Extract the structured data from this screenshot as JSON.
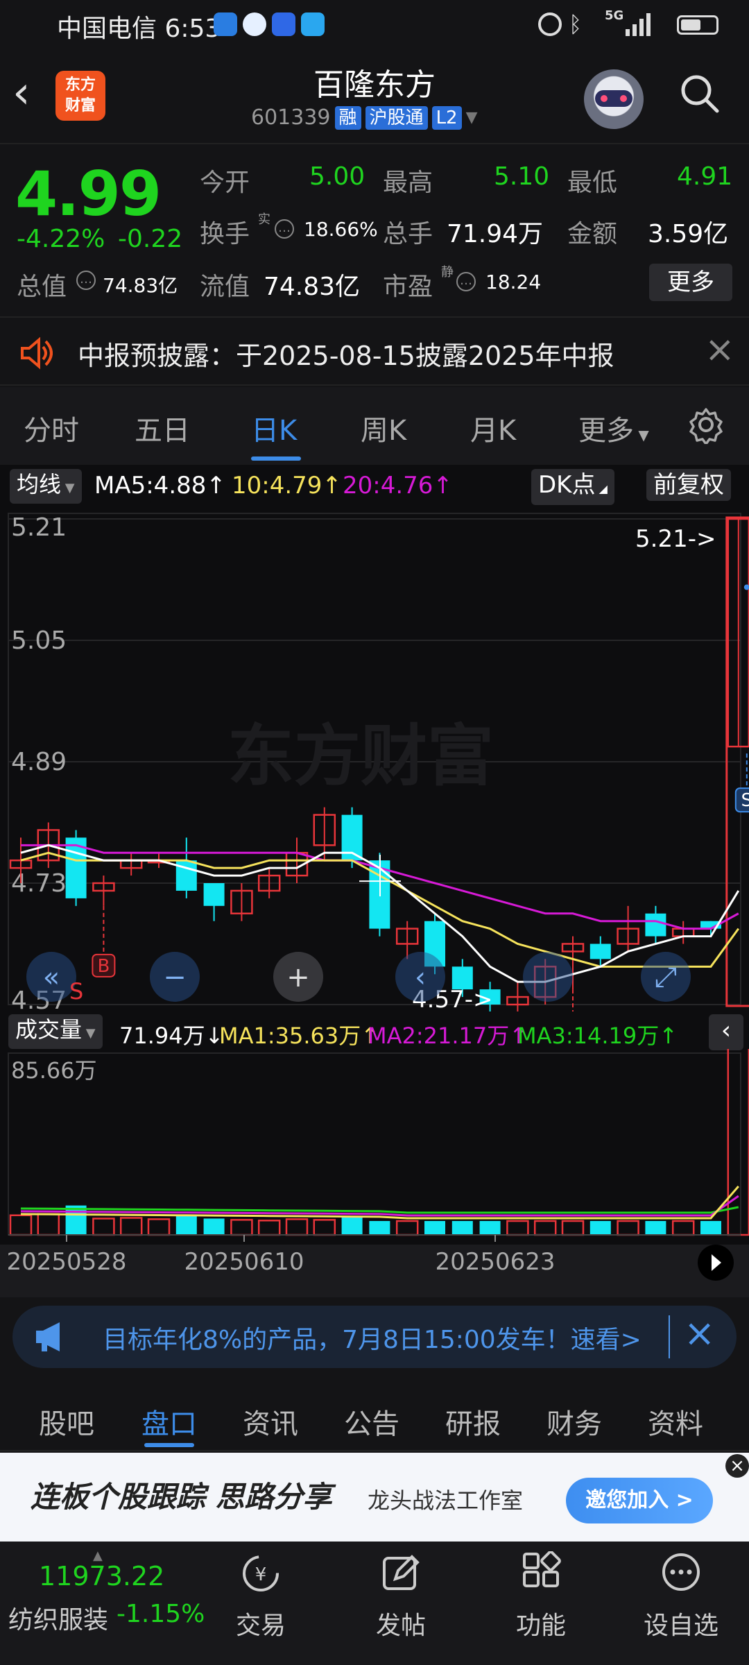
{
  "status_bar": {
    "carrier": "中国电信 6:53",
    "net": "5G"
  },
  "header": {
    "logo_line1": "东方",
    "logo_line2": "财富",
    "title": "百隆东方",
    "code": "601339",
    "tags": [
      "融",
      "沪股通",
      "L2"
    ]
  },
  "quote": {
    "price": "4.99",
    "change_pct": "-4.22%",
    "change_amt": "-0.22",
    "open_label": "今开",
    "open": "5.00",
    "high_label": "最高",
    "high": "5.10",
    "low_label": "最低",
    "low": "4.91",
    "turnover_label": "换手",
    "turnover_sup": "实",
    "turnover": "18.66%",
    "volume_label": "总手",
    "volume": "71.94万",
    "amount_label": "金额",
    "amount": "3.59亿",
    "mktcap_label": "总值",
    "mktcap": "74.83亿",
    "float_label": "流值",
    "float": "74.83亿",
    "pe_label": "市盈",
    "pe_sup": "静",
    "pe": "18.24",
    "more": "更多"
  },
  "notice": {
    "text": "中报预披露：于2025-08-15披露2025年中报"
  },
  "tabs": [
    "分时",
    "五日",
    "日K",
    "周K",
    "月K",
    "更多"
  ],
  "active_tab": "日K",
  "ma_bar": {
    "selector": "均线",
    "ma5": "MA5:4.88",
    "ma10": "10:4.79",
    "ma20": "20:4.76",
    "dk": "DK点",
    "fq": "前复权"
  },
  "colors": {
    "up": "#e8353a",
    "down": "#13e6f2",
    "ma5": "#ffffff",
    "ma10": "#f6e35c",
    "ma20": "#d61ad6",
    "green": "#1fd41f",
    "accent": "#3d8ce8"
  },
  "chart_data": {
    "type": "candlestick",
    "y_ticks": [
      "5.21",
      "5.05",
      "4.89",
      "4.73",
      "4.57"
    ],
    "ylim": [
      4.57,
      5.21
    ],
    "high_marker": "5.21->",
    "low_marker": "4.57->",
    "watermark": "东方财富",
    "candles": [
      {
        "o": 4.75,
        "c": 4.76,
        "h": 4.79,
        "l": 4.73,
        "dir": "up"
      },
      {
        "o": 4.76,
        "c": 4.8,
        "h": 4.81,
        "l": 4.75,
        "dir": "up"
      },
      {
        "o": 4.79,
        "c": 4.71,
        "h": 4.8,
        "l": 4.7,
        "dir": "down"
      },
      {
        "o": 4.72,
        "c": 4.73,
        "h": 4.74,
        "l": 4.7,
        "dir": "up",
        "marker": "B"
      },
      {
        "o": 4.75,
        "c": 4.76,
        "h": 4.77,
        "l": 4.74,
        "dir": "up"
      },
      {
        "o": 4.76,
        "c": 4.76,
        "h": 4.77,
        "l": 4.75,
        "dir": "up"
      },
      {
        "o": 4.76,
        "c": 4.72,
        "h": 4.79,
        "l": 4.71,
        "dir": "down"
      },
      {
        "o": 4.73,
        "c": 4.7,
        "h": 4.73,
        "l": 4.68,
        "dir": "down"
      },
      {
        "o": 4.69,
        "c": 4.72,
        "h": 4.73,
        "l": 4.68,
        "dir": "up"
      },
      {
        "o": 4.72,
        "c": 4.74,
        "h": 4.75,
        "l": 4.71,
        "dir": "up"
      },
      {
        "o": 4.74,
        "c": 4.77,
        "h": 4.79,
        "l": 4.73,
        "dir": "up"
      },
      {
        "o": 4.78,
        "c": 4.82,
        "h": 4.83,
        "l": 4.76,
        "dir": "up"
      },
      {
        "o": 4.82,
        "c": 4.76,
        "h": 4.83,
        "l": 4.75,
        "dir": "down"
      },
      {
        "o": 4.76,
        "c": 4.67,
        "h": 4.77,
        "l": 4.66,
        "dir": "down"
      },
      {
        "o": 4.65,
        "c": 4.67,
        "h": 4.68,
        "l": 4.63,
        "dir": "up"
      },
      {
        "o": 4.68,
        "c": 4.62,
        "h": 4.69,
        "l": 4.61,
        "dir": "down"
      },
      {
        "o": 4.62,
        "c": 4.59,
        "h": 4.63,
        "l": 4.58,
        "dir": "down"
      },
      {
        "o": 4.59,
        "c": 4.57,
        "h": 4.6,
        "l": 4.56,
        "dir": "down"
      },
      {
        "o": 4.57,
        "c": 4.58,
        "h": 4.6,
        "l": 4.53,
        "dir": "up"
      },
      {
        "o": 4.58,
        "c": 4.62,
        "h": 4.63,
        "l": 4.57,
        "dir": "up"
      },
      {
        "o": 4.64,
        "c": 4.65,
        "h": 4.66,
        "l": 4.59,
        "dir": "up",
        "marker": "B"
      },
      {
        "o": 4.65,
        "c": 4.63,
        "h": 4.66,
        "l": 4.62,
        "dir": "down"
      },
      {
        "o": 4.65,
        "c": 4.67,
        "h": 4.7,
        "l": 4.64,
        "dir": "up"
      },
      {
        "o": 4.69,
        "c": 4.66,
        "h": 4.7,
        "l": 4.65,
        "dir": "down"
      },
      {
        "o": 4.67,
        "c": 4.66,
        "h": 4.68,
        "l": 4.65,
        "dir": "up"
      },
      {
        "o": 4.68,
        "c": 4.67,
        "h": 4.68,
        "l": 4.66,
        "dir": "down"
      },
      {
        "o": 4.91,
        "c": 5.21,
        "h": 5.21,
        "l": 4.91,
        "dir": "up",
        "marker": "S"
      }
    ],
    "ma5": [
      4.77,
      4.78,
      4.77,
      4.76,
      4.76,
      4.76,
      4.75,
      4.74,
      4.74,
      4.75,
      4.75,
      4.77,
      4.77,
      4.75,
      4.72,
      4.69,
      4.66,
      4.62,
      4.6,
      4.6,
      4.61,
      4.62,
      4.64,
      4.65,
      4.66,
      4.66,
      4.72
    ],
    "ma10": [
      4.76,
      4.77,
      4.76,
      4.76,
      4.76,
      4.76,
      4.76,
      4.75,
      4.75,
      4.76,
      4.76,
      4.76,
      4.76,
      4.74,
      4.72,
      4.7,
      4.68,
      4.67,
      4.65,
      4.64,
      4.63,
      4.62,
      4.62,
      4.62,
      4.62,
      4.62,
      4.67
    ],
    "ma20": [
      4.78,
      4.78,
      4.78,
      4.77,
      4.77,
      4.77,
      4.77,
      4.77,
      4.77,
      4.77,
      4.77,
      4.76,
      4.76,
      4.75,
      4.74,
      4.73,
      4.72,
      4.71,
      4.7,
      4.69,
      4.69,
      4.68,
      4.68,
      4.68,
      4.67,
      4.67,
      4.69
    ],
    "volume": {
      "ymax_label": "85.66万",
      "current": "71.94万",
      "ma1": "MA1:35.63万",
      "ma2": "MA2:21.17万",
      "ma3": "MA3:14.19万",
      "values": [
        3.0,
        3.2,
        4.5,
        2.5,
        2.6,
        2.4,
        3.1,
        2.5,
        2.3,
        2.2,
        2.4,
        2.3,
        2.9,
        2.0,
        1.4,
        1.5,
        1.6,
        1.5,
        1.4,
        1.4,
        1.5,
        1.5,
        1.4,
        1.3,
        1.4,
        1.4,
        71.94
      ]
    },
    "x_ticks": [
      "20250528",
      "20250610",
      "20250623"
    ]
  },
  "volume_bar_label": "成交量",
  "ad_banner": "目标年化8%的产品，7月8日15:00发车！速看>",
  "tabs2": [
    "股吧",
    "盘口",
    "资讯",
    "公告",
    "研报",
    "财务",
    "资料"
  ],
  "active_tab2": "盘口",
  "ad2": {
    "headline": "连板个股跟踪 思路分享",
    "sub": "龙头战法工作室",
    "button": "邀您加入 >"
  },
  "bottom": {
    "index_value": "11973.22",
    "index_name": "纺织服装",
    "index_change": "-1.15%",
    "items": [
      "交易",
      "发帖",
      "功能",
      "设自选"
    ]
  }
}
